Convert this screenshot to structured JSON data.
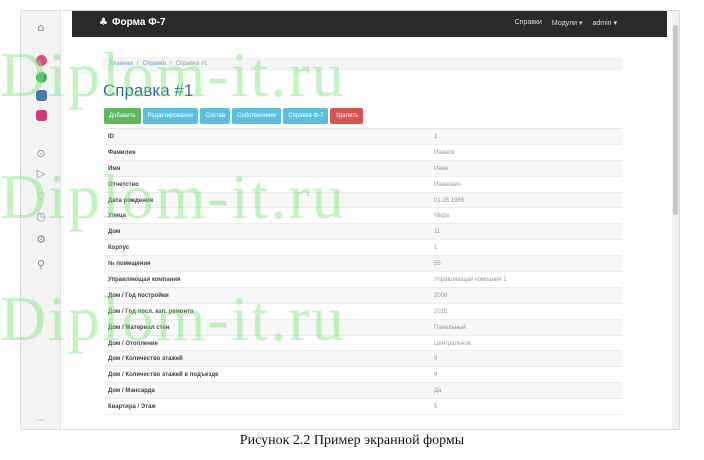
{
  "colors": {
    "navbar_bg": "#2a2a2a",
    "btn_green": "#5cb85c",
    "btn_blue": "#5bc0de",
    "btn_red": "#d9534f",
    "title": "#2f6ea0"
  },
  "sidebar": {
    "icons": [
      {
        "name": "home-icon",
        "glyph": "⌂",
        "color": "#8a8a8a"
      },
      {
        "name": "messenger-icon",
        "glyph": "●",
        "color": "#e0507a"
      },
      {
        "name": "whatsapp-icon",
        "glyph": "●",
        "color": "#42b34a"
      },
      {
        "name": "vk-icon",
        "glyph": "■",
        "color": "#4a76a8"
      },
      {
        "name": "instagram-icon",
        "glyph": "■",
        "color": "#d03c7b"
      },
      {
        "name": "play-circle-icon",
        "glyph": "⊙",
        "color": "#8a8a8a"
      },
      {
        "name": "send-icon",
        "glyph": "▷",
        "color": "#8a8a8a"
      },
      {
        "name": "heart-icon",
        "glyph": "♡",
        "color": "#8a8a8a"
      },
      {
        "name": "clock-icon",
        "glyph": "◷",
        "color": "#8a8a8a"
      },
      {
        "name": "settings-icon",
        "glyph": "⚙",
        "color": "#8a8a8a"
      },
      {
        "name": "location-icon",
        "glyph": "⚲",
        "color": "#8a8a8a"
      }
    ],
    "more": "···"
  },
  "navbar": {
    "brand_icon": "♣",
    "brand": "Форма Ф-7",
    "menu": [
      "Справки",
      "Модули ▾",
      "admin ▾"
    ]
  },
  "breadcrumb": {
    "items": [
      "Главная",
      "Справки",
      "Справка #1"
    ],
    "separator": "/"
  },
  "page": {
    "title": "Справка #1"
  },
  "actions": [
    {
      "label": "Добавить",
      "color": "#5cb85c"
    },
    {
      "label": "Редактирование",
      "color": "#5bc0de"
    },
    {
      "label": "Состав",
      "color": "#5bc0de"
    },
    {
      "label": "Собственники",
      "color": "#5bc0de"
    },
    {
      "label": "Справка Ф-7",
      "color": "#5bc0de"
    },
    {
      "label": "Удалить",
      "color": "#d9534f"
    }
  ],
  "table": {
    "rows": [
      {
        "label": "ID",
        "value": "1"
      },
      {
        "label": "Фамилия",
        "value": "Иванов"
      },
      {
        "label": "Имя",
        "value": "Иван"
      },
      {
        "label": "Отчетство",
        "value": "Иванович"
      },
      {
        "label": "Дата рождения",
        "value": "01.05.1985"
      },
      {
        "label": "Улица",
        "value": "Мира"
      },
      {
        "label": "Дом",
        "value": "11"
      },
      {
        "label": "Корпус",
        "value": "1"
      },
      {
        "label": "№ помещения",
        "value": "55"
      },
      {
        "label": "Управляющая компания",
        "value": "Управляющая компания 1"
      },
      {
        "label": "Дом / Год постройки",
        "value": "2008"
      },
      {
        "label": "Дом / Год посл. кап. ремонта",
        "value": "2015"
      },
      {
        "label": "Дом / Материал стен",
        "value": "Панельный"
      },
      {
        "label": "Дом / Отопление",
        "value": "Центральное"
      },
      {
        "label": "Дом / Количество этажей",
        "value": "9"
      },
      {
        "label": "Дом / Количество этажей в подъезде",
        "value": "9"
      },
      {
        "label": "Дом / Мансарда",
        "value": "Да"
      },
      {
        "label": "Квартира / Этаж",
        "value": "5"
      }
    ]
  },
  "watermark": "Diplom-it.ru",
  "caption": "Рисунок 2.2 Пример экранной формы"
}
